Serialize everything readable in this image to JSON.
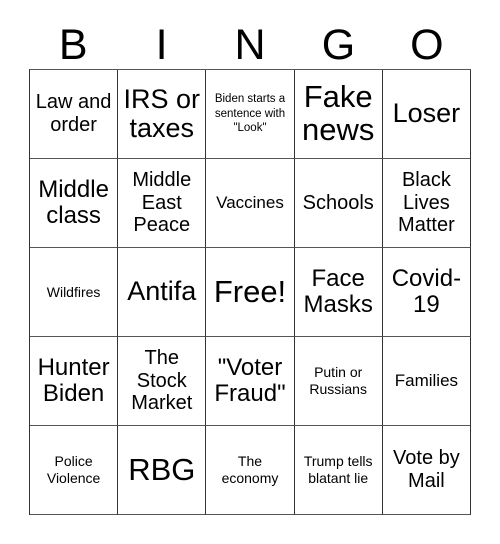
{
  "card": {
    "header_letters": [
      "B",
      "I",
      "N",
      "G",
      "O"
    ],
    "colors": {
      "background": "#ffffff",
      "text": "#000000",
      "grid_line": "#333333"
    },
    "rows": [
      [
        {
          "text": "Law and order",
          "size": "md"
        },
        {
          "text": "IRS or taxes",
          "size": "xl"
        },
        {
          "text": "Biden starts a sentence with \"Look\"",
          "size": "xxs"
        },
        {
          "text": "Fake news",
          "size": "xxl"
        },
        {
          "text": "Loser",
          "size": "xl"
        }
      ],
      [
        {
          "text": "Middle class",
          "size": "lg"
        },
        {
          "text": "Middle East Peace",
          "size": "md"
        },
        {
          "text": "Vaccines",
          "size": "sm"
        },
        {
          "text": "Schools",
          "size": "md"
        },
        {
          "text": "Black Lives Matter",
          "size": "md"
        }
      ],
      [
        {
          "text": "Wildfires",
          "size": "xs"
        },
        {
          "text": "Antifa",
          "size": "xl"
        },
        {
          "text": "Free!",
          "size": "xxl"
        },
        {
          "text": "Face Masks",
          "size": "lg"
        },
        {
          "text": "Covid-19",
          "size": "lg"
        }
      ],
      [
        {
          "text": "Hunter Biden",
          "size": "lg"
        },
        {
          "text": "The Stock Market",
          "size": "md"
        },
        {
          "text": "\"Voter Fraud\"",
          "size": "lg"
        },
        {
          "text": "Putin or Russians",
          "size": "xs"
        },
        {
          "text": "Families",
          "size": "sm"
        }
      ],
      [
        {
          "text": "Police Violence",
          "size": "xs"
        },
        {
          "text": "RBG",
          "size": "xxl"
        },
        {
          "text": "The economy",
          "size": "xs"
        },
        {
          "text": "Trump tells blatant lie",
          "size": "xs"
        },
        {
          "text": "Vote by Mail",
          "size": "md"
        }
      ]
    ]
  }
}
